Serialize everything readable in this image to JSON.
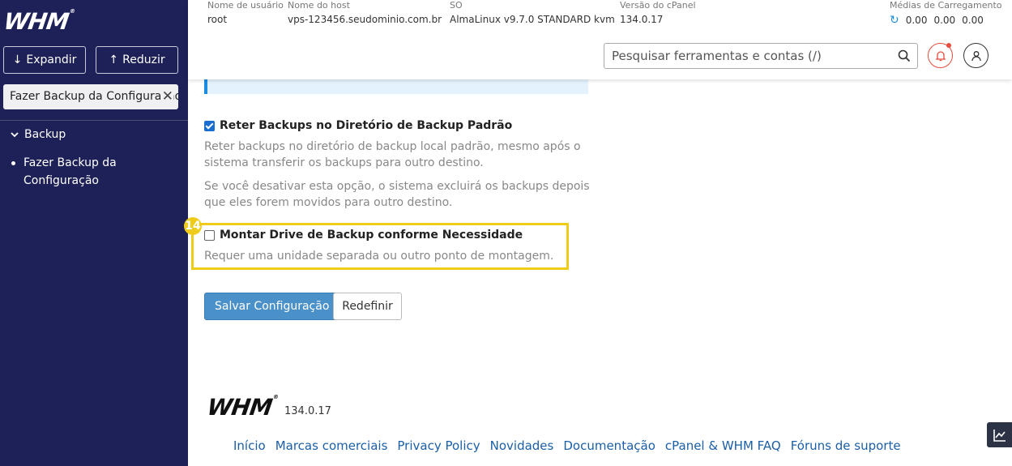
{
  "sidebar": {
    "logo": "WHM",
    "expand_label": "Expandir",
    "reduce_label": "Reduzir",
    "search_value": "Fazer Backup da Configuração",
    "group_label": "Backup",
    "item_label": "Fazer Backup da Configuração"
  },
  "header": {
    "username_label": "Nome de usuário",
    "username": "root",
    "hostname_label": "Nome do host",
    "hostname": "vps-123456.seudominio.com.br",
    "os_label": "SO",
    "os": "AlmaLinux v9.7.0 STANDARD kvm",
    "cpanel_label": "Versão do cPanel",
    "cpanel_version": "134.0.17",
    "load_label": "Médias de Carregamento",
    "load_values": [
      "0.00",
      "0.00",
      "0.00"
    ],
    "search_placeholder": "Pesquisar ferramentas e contas (/)"
  },
  "form": {
    "retain_label": "Reter Backups no Diretório de Backup Padrão",
    "retain_help_1": "Reter backups no diretório de backup local padrão, mesmo após o sistema transferir os backups para outro destino.",
    "retain_help_2": "Se você desativar esta opção, o sistema excluirá os backups depois que eles forem movidos para outro destino.",
    "mount_label": "Montar Drive de Backup conforme Necessidade",
    "mount_help": "Requer uma unidade separada ou outro ponto de montagem.",
    "step_number": "14",
    "save_label": "Salvar Configuração",
    "reset_label": "Redefinir"
  },
  "footer": {
    "logo": "WHM",
    "version": "134.0.17",
    "links": [
      "Início",
      "Marcas comerciais",
      "Privacy Policy",
      "Novidades",
      "Documentação",
      "cPanel & WHM FAQ",
      "Fóruns de suporte"
    ]
  },
  "colors": {
    "sidebar_bg": "#1e2157",
    "accent": "#1b8ce0",
    "highlight": "#f0cc1a",
    "primary_button": "#4a90c9"
  }
}
